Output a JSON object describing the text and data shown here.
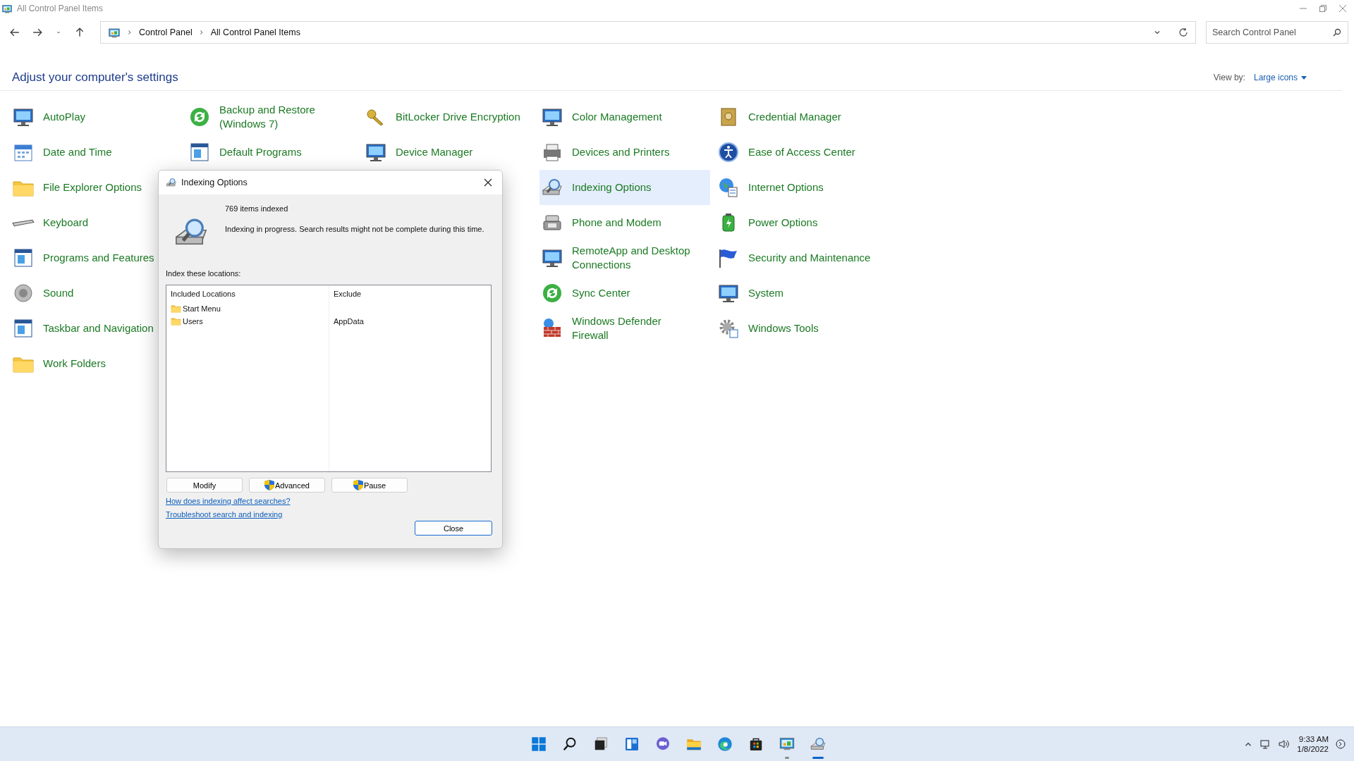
{
  "window": {
    "title": "All Control Panel Items"
  },
  "address": {
    "breadcrumb": [
      "Control Panel",
      "All Control Panel Items"
    ],
    "search_placeholder": "Search Control Panel"
  },
  "header": {
    "title": "Adjust your computer's settings",
    "view_by_label": "View by:",
    "view_by_value": "Large icons"
  },
  "columns": [
    [
      {
        "label": "AutoPlay",
        "selected": false
      },
      {
        "label": "Date and Time",
        "selected": false
      },
      {
        "label": "File Explorer Options",
        "selected": false
      },
      {
        "label": "Keyboard",
        "selected": false
      },
      {
        "label": "Programs and Features",
        "selected": false
      },
      {
        "label": "Sound",
        "selected": false
      },
      {
        "label": "Taskbar and Navigation",
        "selected": false
      },
      {
        "label": "Work Folders",
        "selected": false
      }
    ],
    [
      {
        "label": "Backup and Restore\n(Windows 7)",
        "selected": false
      },
      {
        "label": "Default Programs",
        "selected": false
      }
    ],
    [
      {
        "label": "BitLocker Drive Encryption",
        "selected": false
      },
      {
        "label": "Device Manager",
        "selected": false
      }
    ],
    [
      {
        "label": "Color Management",
        "selected": false
      },
      {
        "label": "Devices and Printers",
        "selected": false
      },
      {
        "label": "Indexing Options",
        "selected": true
      },
      {
        "label": "Phone and Modem",
        "selected": false
      },
      {
        "label": "RemoteApp and Desktop\nConnections",
        "selected": false
      },
      {
        "label": "Sync Center",
        "selected": false
      },
      {
        "label": "Windows Defender\nFirewall",
        "selected": false
      }
    ],
    [
      {
        "label": "Credential Manager",
        "selected": false
      },
      {
        "label": "Ease of Access Center",
        "selected": false
      },
      {
        "label": "Internet Options",
        "selected": false
      },
      {
        "label": "Power Options",
        "selected": false
      },
      {
        "label": "Security and Maintenance",
        "selected": false
      },
      {
        "label": "System",
        "selected": false
      },
      {
        "label": "Windows Tools",
        "selected": false
      }
    ]
  ],
  "dialog": {
    "title": "Indexing Options",
    "count": "769 items indexed",
    "status": "Indexing in progress. Search results might not be complete during this time.",
    "locations_label": "Index these locations:",
    "list_columns": [
      "Included Locations",
      "Exclude"
    ],
    "rows": [
      {
        "location": "Start Menu",
        "exclude": ""
      },
      {
        "location": "Users",
        "exclude": "AppData"
      }
    ],
    "buttons": [
      {
        "label": "Modify",
        "shield": false
      },
      {
        "label": "Advanced",
        "shield": true
      },
      {
        "label": "Pause",
        "shield": true
      }
    ],
    "links": [
      "How does indexing affect searches?",
      "Troubleshoot search and indexing"
    ],
    "close": "Close"
  },
  "taskbar": {
    "apps": [
      {
        "open": false,
        "focused": false
      },
      {
        "open": false,
        "focused": false
      },
      {
        "open": false,
        "focused": false
      },
      {
        "open": false,
        "focused": false
      },
      {
        "open": false,
        "focused": false
      },
      {
        "open": false,
        "focused": false
      },
      {
        "open": false,
        "focused": false
      },
      {
        "open": false,
        "focused": false
      },
      {
        "open": true,
        "focused": false
      },
      {
        "open": true,
        "focused": true
      }
    ],
    "time": "9:33 AM",
    "date": "1/8/2022"
  }
}
